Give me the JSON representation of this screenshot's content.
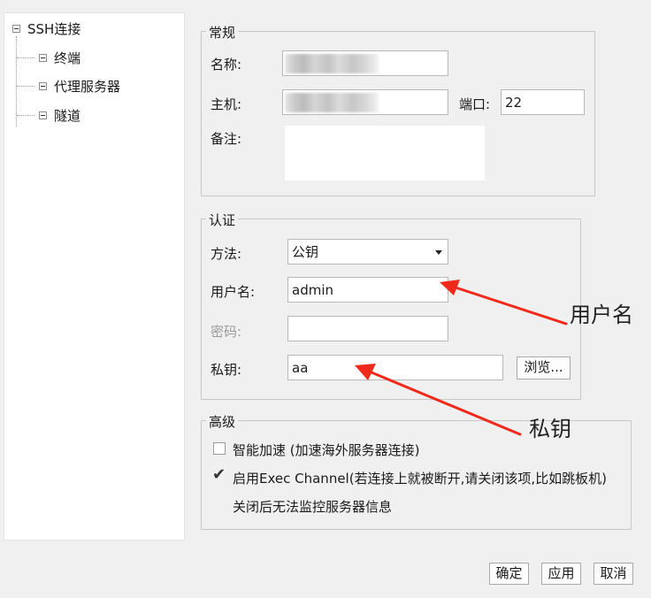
{
  "tree": {
    "root": "SSH连接",
    "children": [
      "终端",
      "代理服务器",
      "隧道"
    ]
  },
  "general": {
    "legend": "常规",
    "name_label": "名称:",
    "host_label": "主机:",
    "port_label": "端口:",
    "port_value": "22",
    "note_label": "备注:"
  },
  "auth": {
    "legend": "认证",
    "method_label": "方法:",
    "method_value": "公钥",
    "user_label": "用户名:",
    "user_value": "admin",
    "password_label": "密码:",
    "key_label": "私钥:",
    "key_value": "aa",
    "browse_label": "浏览..."
  },
  "advanced": {
    "legend": "高级",
    "accel_label": "智能加速 (加速海外服务器连接)",
    "accel_checked": false,
    "exec_label": "启用Exec Channel(若连接上就被断开,请关闭该项,比如跳板机)",
    "exec_checked": true,
    "exec_note": "关闭后无法监控服务器信息"
  },
  "buttons": {
    "ok": "确定",
    "apply": "应用",
    "cancel": "取消"
  },
  "annotations": {
    "username": "用户名",
    "private_key": "私钥",
    "arrow_color": "#f02a1a"
  }
}
